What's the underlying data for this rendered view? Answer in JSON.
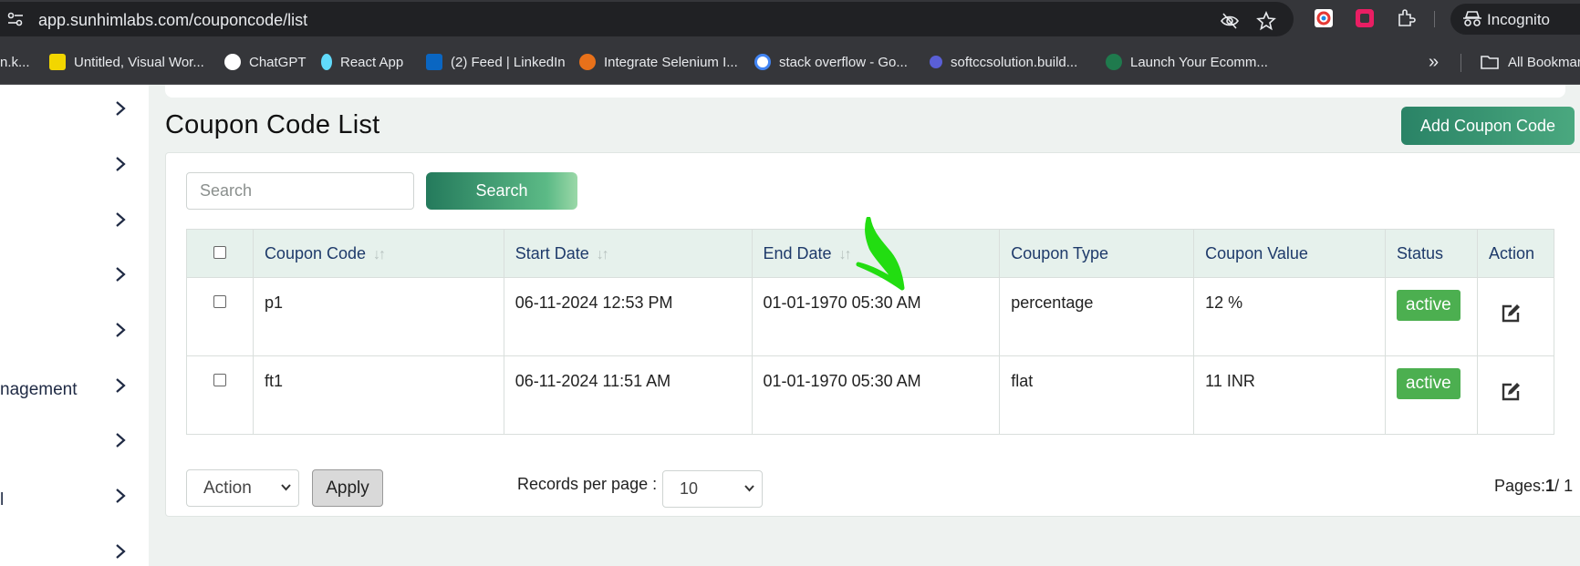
{
  "browser": {
    "url": "app.sunhimlabs.com/couponcode/list",
    "incognito_label": "Incognito",
    "bookmarks": [
      {
        "label": "n.k...",
        "color": "#35363a"
      },
      {
        "label": "Untitled, Visual Wor...",
        "color": "#f2d600"
      },
      {
        "label": "ChatGPT",
        "color": "#ffffff"
      },
      {
        "label": "React App",
        "color": "#61dafb"
      },
      {
        "label": "(2) Feed | LinkedIn",
        "color": "#0a66c2"
      },
      {
        "label": "Integrate Selenium I...",
        "color": "#e8711a"
      },
      {
        "label": "stack overflow - Go...",
        "color": "#4285f4"
      },
      {
        "label": "softccsolution.build...",
        "color": "#5a5fd6"
      },
      {
        "label": "Launch Your Ecomm...",
        "color": "#1f7a4d"
      }
    ],
    "all_bookmarks": "All Bookmar"
  },
  "sidebar": {
    "labels": [
      "nagement",
      "l"
    ]
  },
  "main": {
    "title": "Coupon Code List",
    "add_button": "Add Coupon Code",
    "search_placeholder": "Search",
    "search_button": "Search",
    "columns": [
      "Coupon Code",
      "Start Date",
      "End Date",
      "Coupon Type",
      "Coupon Value",
      "Status",
      "Action"
    ],
    "rows": [
      {
        "code": "p1",
        "start": "06-11-2024 12:53 PM",
        "end": "01-01-1970 05:30 AM",
        "type": "percentage",
        "value": "12 %",
        "status": "active"
      },
      {
        "code": "ft1",
        "start": "06-11-2024 11:51 AM",
        "end": "01-01-1970 05:30 AM",
        "type": "flat",
        "value": "11 INR",
        "status": "active"
      }
    ],
    "action_select": "Action",
    "apply_button": "Apply",
    "records_label": "Records per page :",
    "records_value": "10",
    "pages_label": "Pages:",
    "pages_current": "1",
    "pages_total": "/ 1"
  },
  "colors": {
    "accent": "#2a8366",
    "active_badge": "#4caf50",
    "annotation": "#22dd11"
  }
}
